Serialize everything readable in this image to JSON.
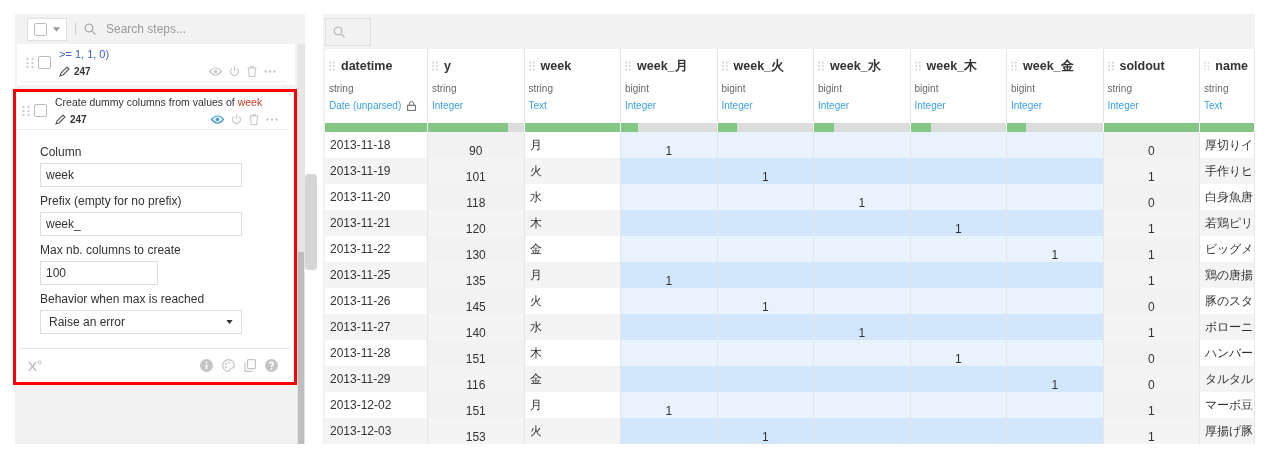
{
  "steps_panel": {
    "search": {
      "placeholder": "Search steps..."
    },
    "steps": [
      {
        "kind": "formula",
        "text": ">= 1, 1, 0)",
        "count": "247",
        "preview": false,
        "highlighted": false
      },
      {
        "kind": "dummy",
        "text": "Create dummy columns from values of",
        "column": "week",
        "count": "247",
        "preview": true,
        "highlighted": true,
        "fields": [
          {
            "kind": "text",
            "label": "Column",
            "value": "week"
          },
          {
            "kind": "text",
            "label": "Prefix (empty for no prefix)",
            "value": "week_"
          },
          {
            "kind": "number",
            "label": "Max nb. columns to create",
            "value": "100"
          },
          {
            "kind": "select",
            "label": "Behavior when max is reached",
            "value": "Raise an error"
          }
        ]
      }
    ]
  },
  "table": {
    "columns": [
      {
        "kind": "text",
        "name": "datetime",
        "storage": "string",
        "meaning": "Date (unparsed)",
        "locked": true,
        "level": 1
      },
      {
        "kind": "number",
        "name": "y",
        "storage": "string",
        "meaning": "Integer",
        "locked": false,
        "level": 0.84
      },
      {
        "kind": "text",
        "name": "week",
        "storage": "string",
        "meaning": "Text",
        "locked": false,
        "level": 1
      },
      {
        "kind": "dummy",
        "name": "week_月",
        "storage": "bigint",
        "meaning": "Integer",
        "locked": false,
        "level": 0.18
      },
      {
        "kind": "dummy",
        "name": "week_火",
        "storage": "bigint",
        "meaning": "Integer",
        "locked": false,
        "level": 0.2
      },
      {
        "kind": "dummy",
        "name": "week_水",
        "storage": "bigint",
        "meaning": "Integer",
        "locked": false,
        "level": 0.21
      },
      {
        "kind": "dummy",
        "name": "week_木",
        "storage": "bigint",
        "meaning": "Integer",
        "locked": false,
        "level": 0.21
      },
      {
        "kind": "dummy",
        "name": "week_金",
        "storage": "bigint",
        "meaning": "Integer",
        "locked": false,
        "level": 0.2
      },
      {
        "kind": "number",
        "name": "soldout",
        "storage": "string",
        "meaning": "Integer",
        "locked": false,
        "level": 1
      },
      {
        "kind": "text",
        "name": "name",
        "storage": "string",
        "meaning": "Text",
        "locked": false,
        "level": 1
      }
    ],
    "rows": [
      [
        "2013-11-18",
        "90",
        "月",
        "1",
        null,
        null,
        null,
        null,
        "0",
        "厚切りイ"
      ],
      [
        "2013-11-19",
        "101",
        "火",
        null,
        "1",
        null,
        null,
        null,
        "1",
        "手作りヒ"
      ],
      [
        "2013-11-20",
        "118",
        "水",
        null,
        null,
        "1",
        null,
        null,
        "0",
        "白身魚唐"
      ],
      [
        "2013-11-21",
        "120",
        "木",
        null,
        null,
        null,
        "1",
        null,
        "1",
        "若鶏ピリ"
      ],
      [
        "2013-11-22",
        "130",
        "金",
        null,
        null,
        null,
        null,
        "1",
        "1",
        "ビッグメ"
      ],
      [
        "2013-11-25",
        "135",
        "月",
        "1",
        null,
        null,
        null,
        null,
        "1",
        "鶏の唐揚"
      ],
      [
        "2013-11-26",
        "145",
        "火",
        null,
        "1",
        null,
        null,
        null,
        "0",
        "豚のスタ"
      ],
      [
        "2013-11-27",
        "140",
        "水",
        null,
        null,
        "1",
        null,
        null,
        "1",
        "ボローニ"
      ],
      [
        "2013-11-28",
        "151",
        "木",
        null,
        null,
        null,
        "1",
        null,
        "0",
        "ハンバー"
      ],
      [
        "2013-11-29",
        "116",
        "金",
        null,
        null,
        null,
        null,
        "1",
        "0",
        "タルタル"
      ],
      [
        "2013-12-02",
        "151",
        "月",
        "1",
        null,
        null,
        null,
        null,
        "1",
        "マーボ豆"
      ],
      [
        "2013-12-03",
        "153",
        "火",
        null,
        "1",
        null,
        null,
        null,
        "1",
        "厚揚げ豚"
      ]
    ]
  }
}
